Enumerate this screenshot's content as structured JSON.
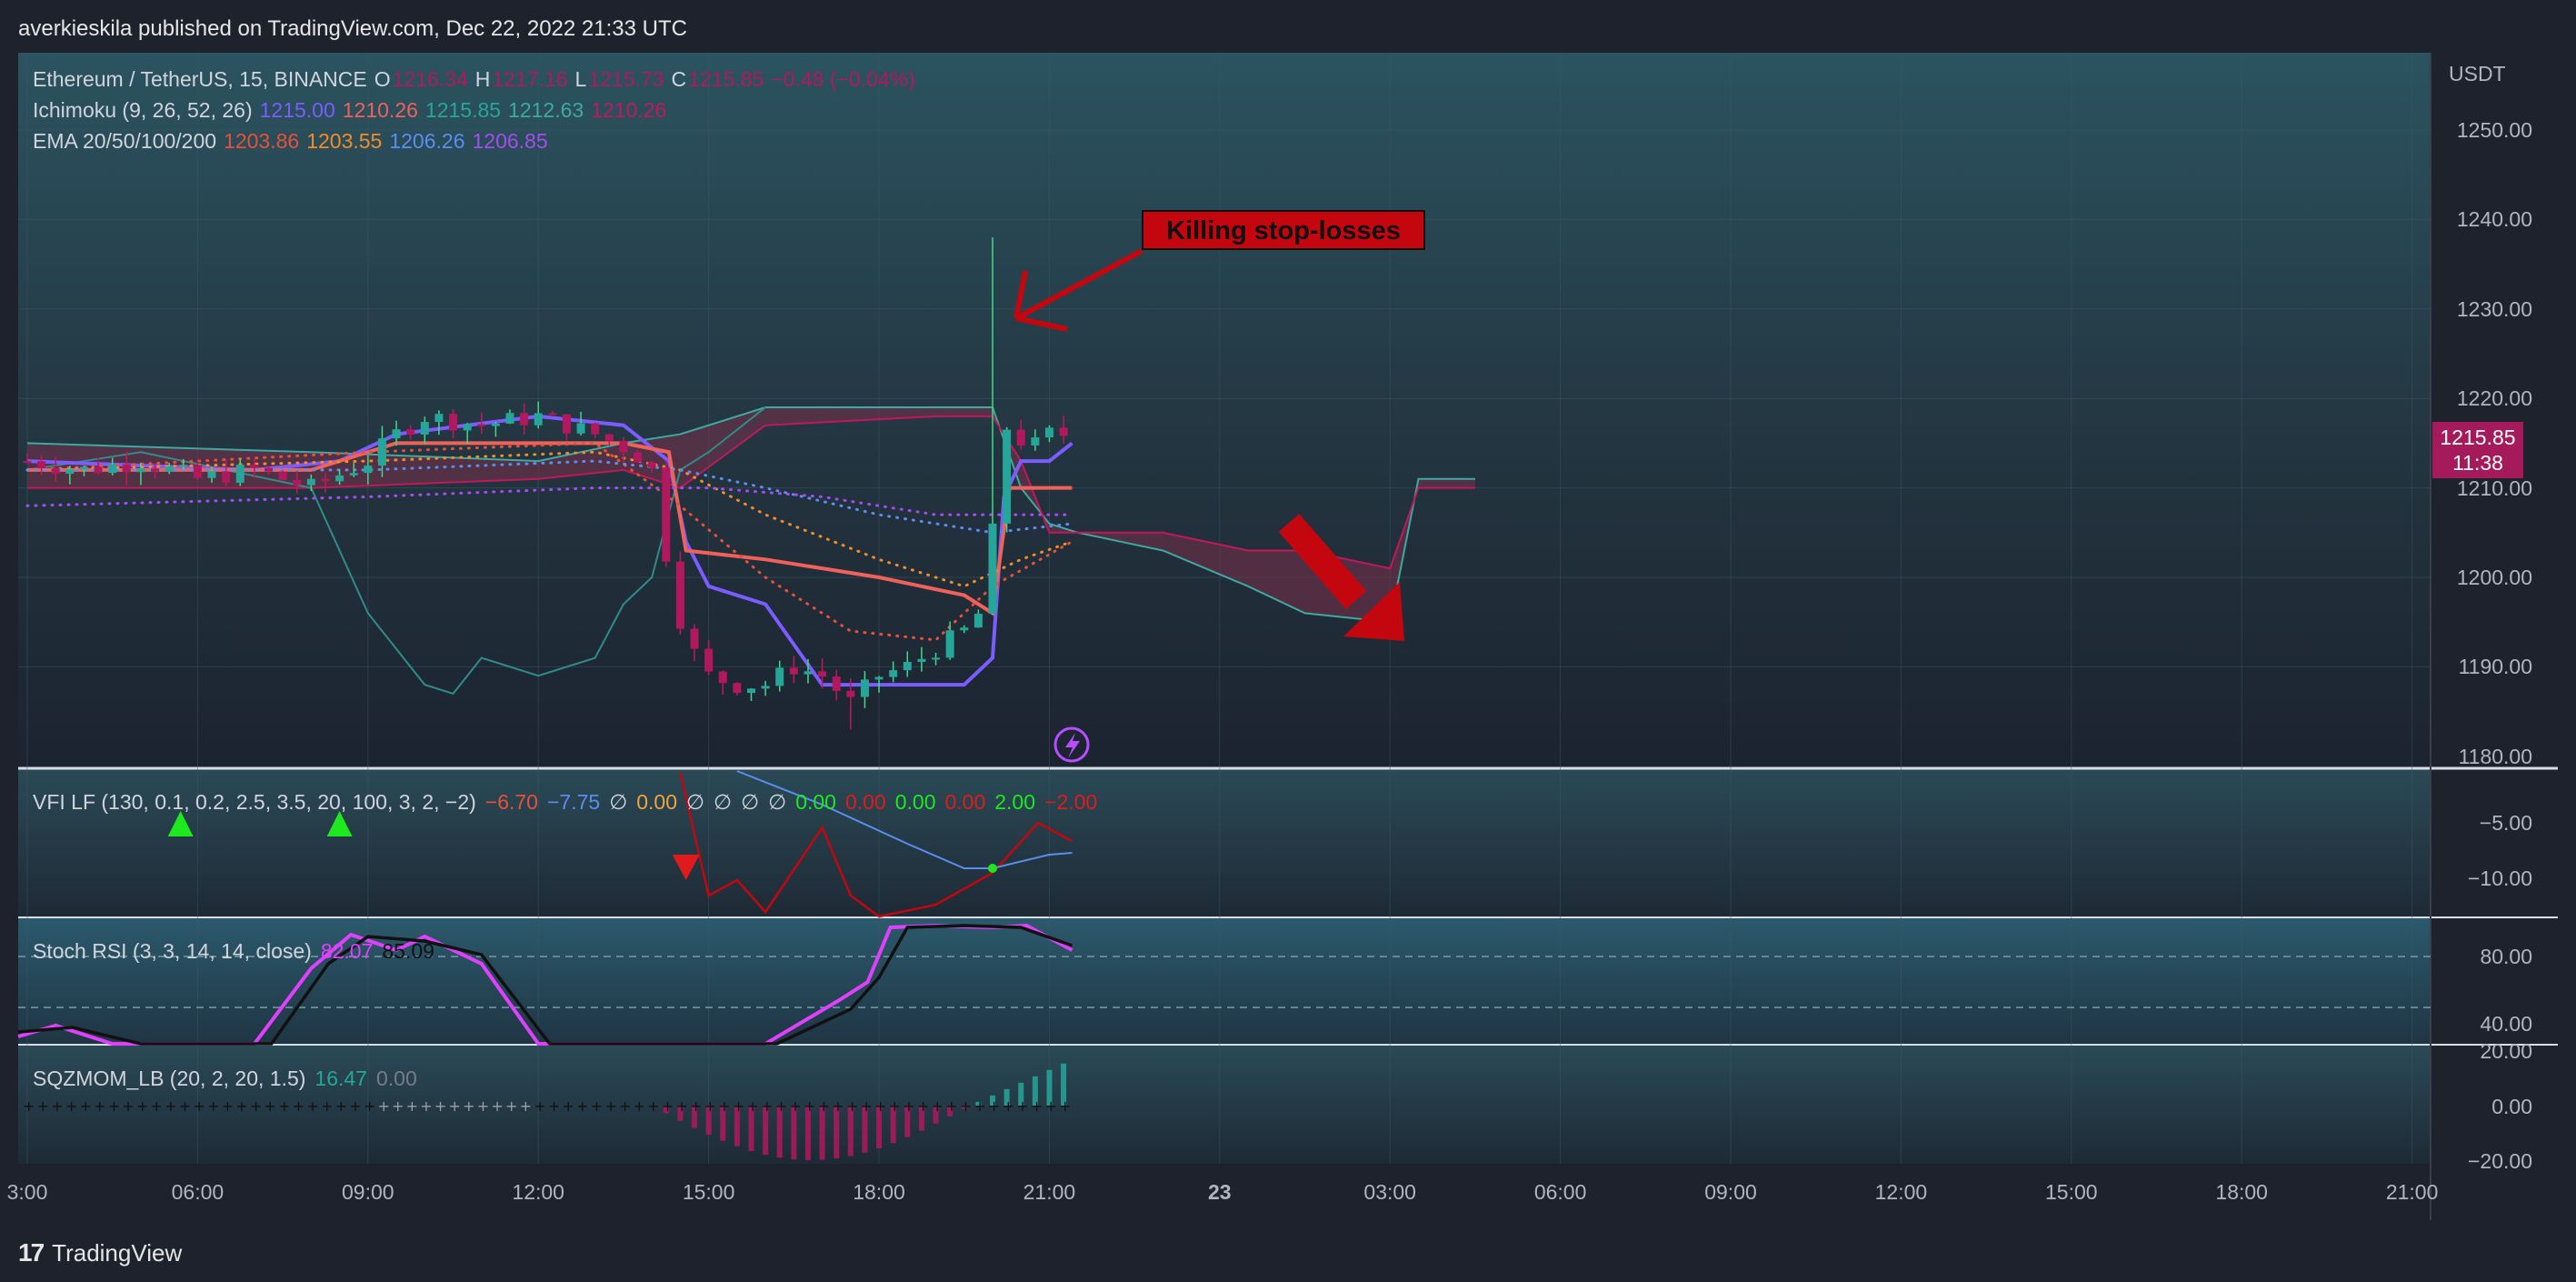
{
  "header": {
    "published": "averkieskila published on TradingView.com, Dec 22, 2022 21:33 UTC"
  },
  "footer": {
    "brand": "TradingView",
    "logo_glyph": "17"
  },
  "symbol_legend": {
    "symbol": "Ethereum / TetherUS, 15, BINANCE",
    "o_label": "O",
    "o": "1216.34",
    "h_label": "H",
    "h": "1217.16",
    "l_label": "L",
    "l": "1215.73",
    "c_label": "C",
    "c": "1215.85",
    "change": "−0.48 (−0.04%)"
  },
  "ichimoku_legend": {
    "name": "Ichimoku (9, 26, 52, 26)",
    "v1": "1215.00",
    "v2": "1210.26",
    "v3": "1215.85",
    "v4": "1212.63",
    "v5": "1210.26"
  },
  "ema_legend": {
    "name": "EMA 20/50/100/200",
    "v1": "1203.86",
    "v2": "1203.55",
    "v3": "1206.26",
    "v4": "1206.85"
  },
  "vfi_legend": {
    "name": "VFI LF (130, 0.1, 0.2, 2.5, 3.5, 20, 100, 3, 2, −2)",
    "v1": "−6.70",
    "v2": "−7.75",
    "v3": "∅",
    "v4": "0.00",
    "v5": "∅",
    "v6": "∅",
    "v7": "∅",
    "v8": "∅",
    "v9": "0.00",
    "v10": "0.00",
    "v11": "0.00",
    "v12": "0.00",
    "v13": "2.00",
    "v14": "−2.00"
  },
  "stoch_legend": {
    "name": "Stoch RSI (3, 3, 14, 14, close)",
    "v1": "82.07",
    "v2": "85.09"
  },
  "sqz_legend": {
    "name": "SQZMOM_LB (20, 2, 20, 1.5)",
    "v1": "16.47",
    "v2": "0.00"
  },
  "price_axis": {
    "currency": "USDT",
    "ticks": [
      "1250.00",
      "1240.00",
      "1230.00",
      "1220.00",
      "1210.00",
      "1200.00",
      "1190.00",
      "1180.00"
    ],
    "last_price": "1215.85",
    "countdown": "11:38"
  },
  "vfi_axis": {
    "ticks": [
      "−5.00",
      "−10.00"
    ]
  },
  "stoch_axis": {
    "ticks": [
      "80.00",
      "40.00"
    ]
  },
  "sqz_axis": {
    "ticks": [
      "20.00",
      "0.00",
      "−20.00"
    ]
  },
  "time_axis": {
    "ticks": [
      "3:00",
      "06:00",
      "09:00",
      "12:00",
      "15:00",
      "18:00",
      "21:00",
      "23",
      "03:00",
      "06:00",
      "09:00",
      "12:00",
      "15:00",
      "18:00",
      "21:00"
    ]
  },
  "annotation": {
    "text": "Killing stop-losses"
  },
  "colors": {
    "background": "#1e222d",
    "pane_top": "#2a4a56",
    "up_candle": "#26a69a",
    "down_candle": "#b2185e",
    "tenkan": "#7b5cff",
    "kijun": "#f0615a",
    "cloud_fill": "#7a2f4a",
    "ema20": "#e8503a",
    "ema50": "#f28c28",
    "ema100": "#5b8def",
    "ema200": "#a54cf0",
    "annotation": "#c4060f",
    "badge": "#a51a5b"
  },
  "chart_data": {
    "type": "candlestick",
    "x_range": [
      "Dec 22 03:00",
      "Dec 23 21:00"
    ],
    "ylim": [
      1180,
      1252
    ],
    "last_close": 1215.85,
    "ohlc_last": {
      "open": 1216.34,
      "high": 1217.16,
      "low": 1215.73,
      "close": 1215.85
    },
    "notable": [
      {
        "time": "Dec 22 ~20:00",
        "event": "spike high",
        "price": 1238
      },
      {
        "time": "Dec 22 ~17:30",
        "event": "session low",
        "price": 1183
      }
    ],
    "indicators": {
      "ichimoku": [
        1215.0,
        1210.26,
        1215.85,
        1212.63,
        1210.26
      ],
      "ema": {
        "20": 1203.86,
        "50": 1203.55,
        "100": 1206.26,
        "200": 1206.85
      },
      "stoch_rsi": {
        "k": 82.07,
        "d": 85.09
      },
      "sqzmom": 16.47
    }
  }
}
